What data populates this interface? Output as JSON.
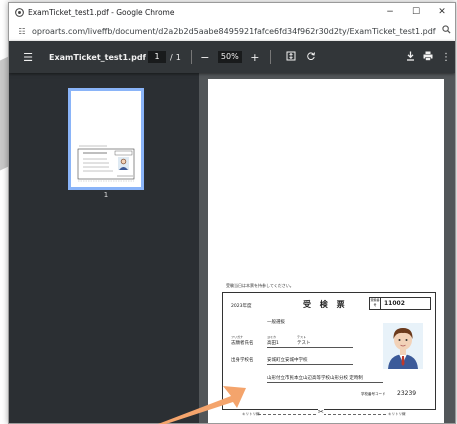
{
  "window": {
    "title": "ExamTicket_test1.pdf - Google Chrome",
    "minimize_glyph": "−",
    "maximize_glyph": "☐",
    "close_glyph": "✕"
  },
  "address": {
    "url": "oproarts.com/liveffb/document/d2a2b2d5aabe8495921fafce6fd34f962r30d2ty/ExamTicket_test1.pdf",
    "icon": "tune-icon",
    "zoom_icon": "zoom-icon"
  },
  "toolbar": {
    "doc_name": "ExamTicket_test1.pdf",
    "current_page": "1",
    "separator": "/",
    "page_count": "1",
    "zoom_out_glyph": "−",
    "zoom_value": "50%",
    "zoom_in_glyph": "+"
  },
  "sidebar": {
    "thumbnail_page_number": "1"
  },
  "document": {
    "notice": "受験当日は本票を持参してください。",
    "ticket": {
      "year": "2023年度",
      "title": "受 検 票",
      "number_label": "受験番号",
      "number": "11002",
      "exam_type": "一般選抜",
      "furigana_label": "フリガナ",
      "name_label": "志願者氏名",
      "surname_furigana": "ヨミカ",
      "given_furigana": "テスト",
      "surname": "高田1",
      "given_name": "テスト",
      "school_label": "出身学校名",
      "school": "安城町立安城中学校",
      "exam_school": "山形付立市民本立山辺高等学校山形分校 定時制",
      "code_label": "学校番号コード",
      "code": "23239",
      "cut_left": "キリトリ線",
      "cut_right": "キリトリ線"
    }
  },
  "colors": {
    "pdf_toolbar": "#323639",
    "sidebar": "#2b2f33",
    "viewer": "#525659",
    "thumb_border": "#8ab4f8",
    "arrow": "#f4a46c"
  }
}
